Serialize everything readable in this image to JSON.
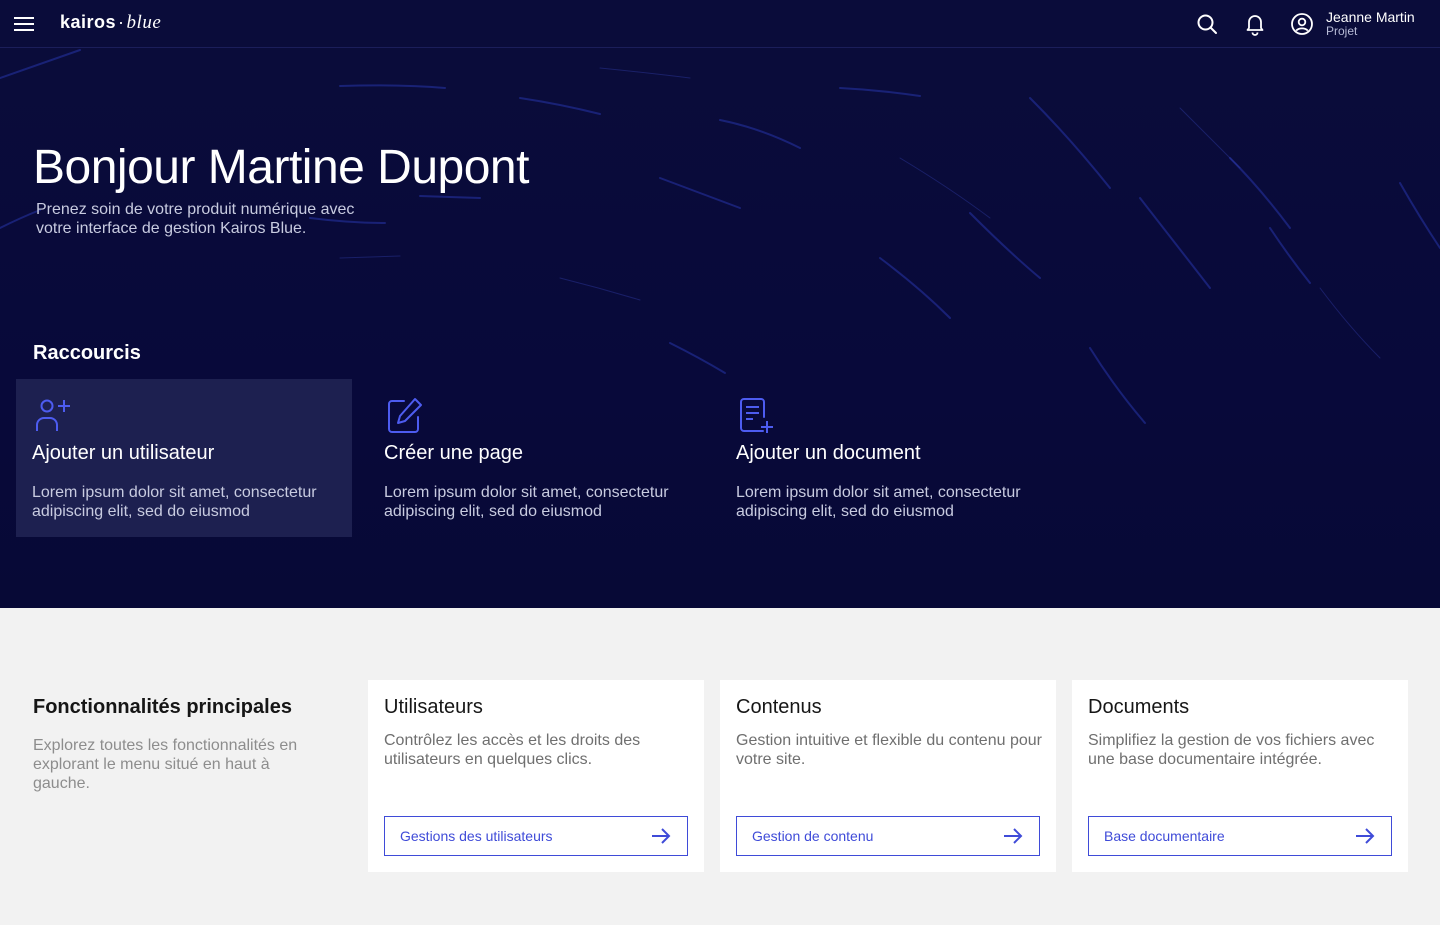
{
  "topbar": {
    "menu_icon": "hamburger-menu-icon",
    "logo": {
      "brand": "kairos",
      "separator": "·",
      "suffix": "blue"
    },
    "icons": [
      "search-icon",
      "bell-icon",
      "user-circle-icon"
    ],
    "user": {
      "name": "Jeanne Martin",
      "role": "Projet"
    }
  },
  "hero": {
    "title": "Bonjour Martine Dupont",
    "subtitle": "Prenez soin de votre produit numérique avec votre interface de gestion Kairos Blue."
  },
  "shortcuts": {
    "label": "Raccourcis",
    "items": [
      {
        "icon": "user-add-icon",
        "title": "Ajouter un utilisateur",
        "description": "Lorem ipsum dolor sit amet, consectetur adipiscing elit, sed do eiusmod",
        "active": true
      },
      {
        "icon": "edit-page-icon",
        "title": "Créer une page",
        "description": "Lorem ipsum dolor sit amet, consectetur adipiscing elit, sed do eiusmod",
        "active": false
      },
      {
        "icon": "add-document-icon",
        "title": "Ajouter un document",
        "description": "Lorem ipsum dolor sit amet, consectetur adipiscing elit, sed do eiusmod",
        "active": false
      }
    ]
  },
  "features": {
    "title": "Fonctionnalités principales",
    "subtitle": "Explorez toutes les fonctionnalités en explorant le menu situé en haut à gauche.",
    "cards": [
      {
        "title": "Utilisateurs",
        "description": "Contrôlez les accès et les droits des utilisateurs en quelques clics.",
        "button": "Gestions des utilisateurs"
      },
      {
        "title": "Contenus",
        "description": "Gestion intuitive et flexible du contenu pour votre site.",
        "button": "Gestion de contenu"
      },
      {
        "title": "Documents",
        "description": "Simplifiez la gestion de vos fichiers avec une base documentaire intégrée.",
        "button": "Base documentaire"
      }
    ]
  },
  "colors": {
    "navy": "#0a0c3a",
    "accent": "#3f4bd8",
    "icon_blue": "#4d5cf0",
    "page_bg": "#f2f2f2"
  }
}
